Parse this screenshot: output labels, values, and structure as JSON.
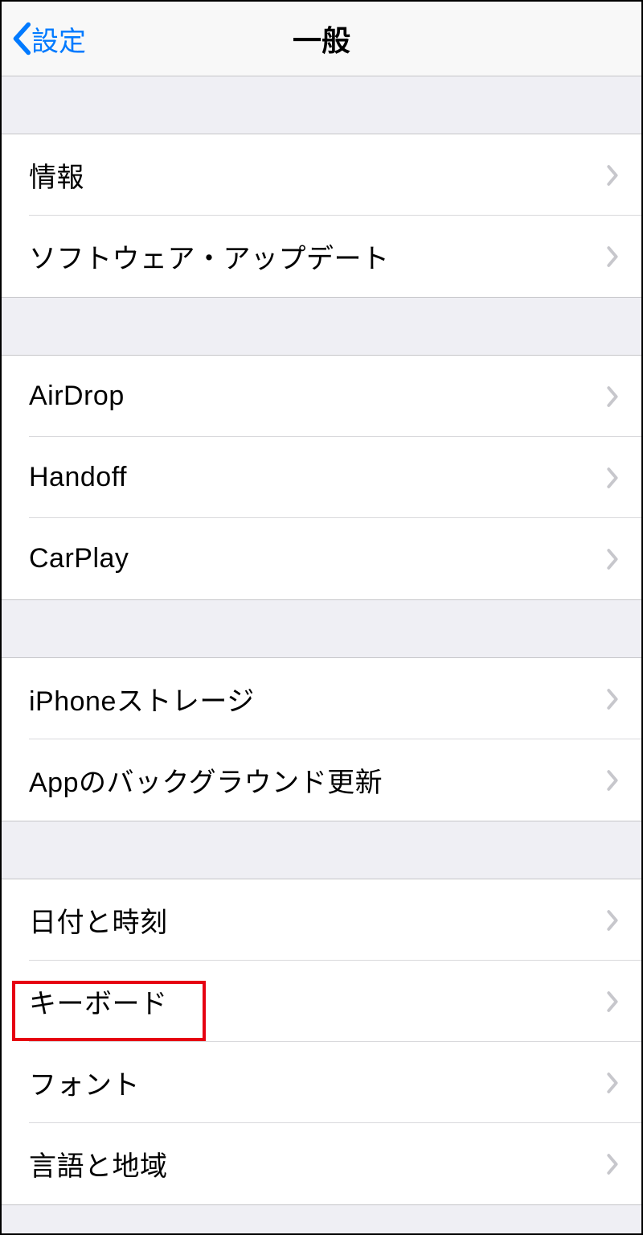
{
  "header": {
    "back_label": "設定",
    "title": "一般"
  },
  "groups": [
    {
      "items": [
        {
          "id": "about",
          "label": "情報"
        },
        {
          "id": "software-update",
          "label": "ソフトウェア・アップデート"
        }
      ]
    },
    {
      "items": [
        {
          "id": "airdrop",
          "label": "AirDrop"
        },
        {
          "id": "handoff",
          "label": "Handoff"
        },
        {
          "id": "carplay",
          "label": "CarPlay"
        }
      ]
    },
    {
      "items": [
        {
          "id": "iphone-storage",
          "label": "iPhoneストレージ"
        },
        {
          "id": "background-app-refresh",
          "label": "Appのバックグラウンド更新"
        }
      ]
    },
    {
      "items": [
        {
          "id": "date-time",
          "label": "日付と時刻"
        },
        {
          "id": "keyboard",
          "label": "キーボード"
        },
        {
          "id": "fonts",
          "label": "フォント"
        },
        {
          "id": "language-region",
          "label": "言語と地域"
        }
      ]
    }
  ]
}
